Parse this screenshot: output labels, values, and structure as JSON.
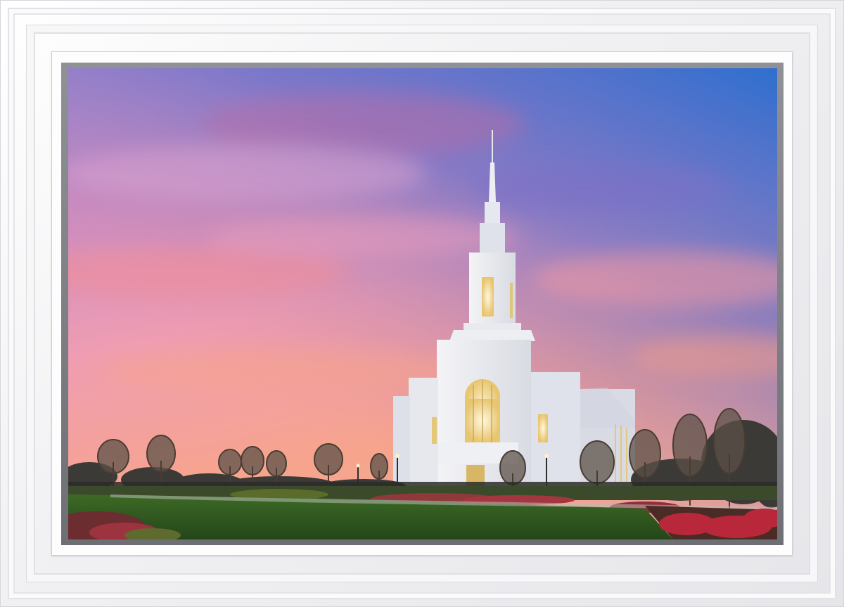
{
  "artwork": {
    "subject": "temple-at-sunset",
    "colors": {
      "frame": "#f3f3f5",
      "liner": "#7c7e83",
      "sky_top": "#3f78cf",
      "sky_mid": "#c56fa0",
      "sky_low": "#f3a58a",
      "temple": "#eef0f3",
      "window_glow": "#f7d27a",
      "lawn": "#2f5a1f"
    }
  }
}
